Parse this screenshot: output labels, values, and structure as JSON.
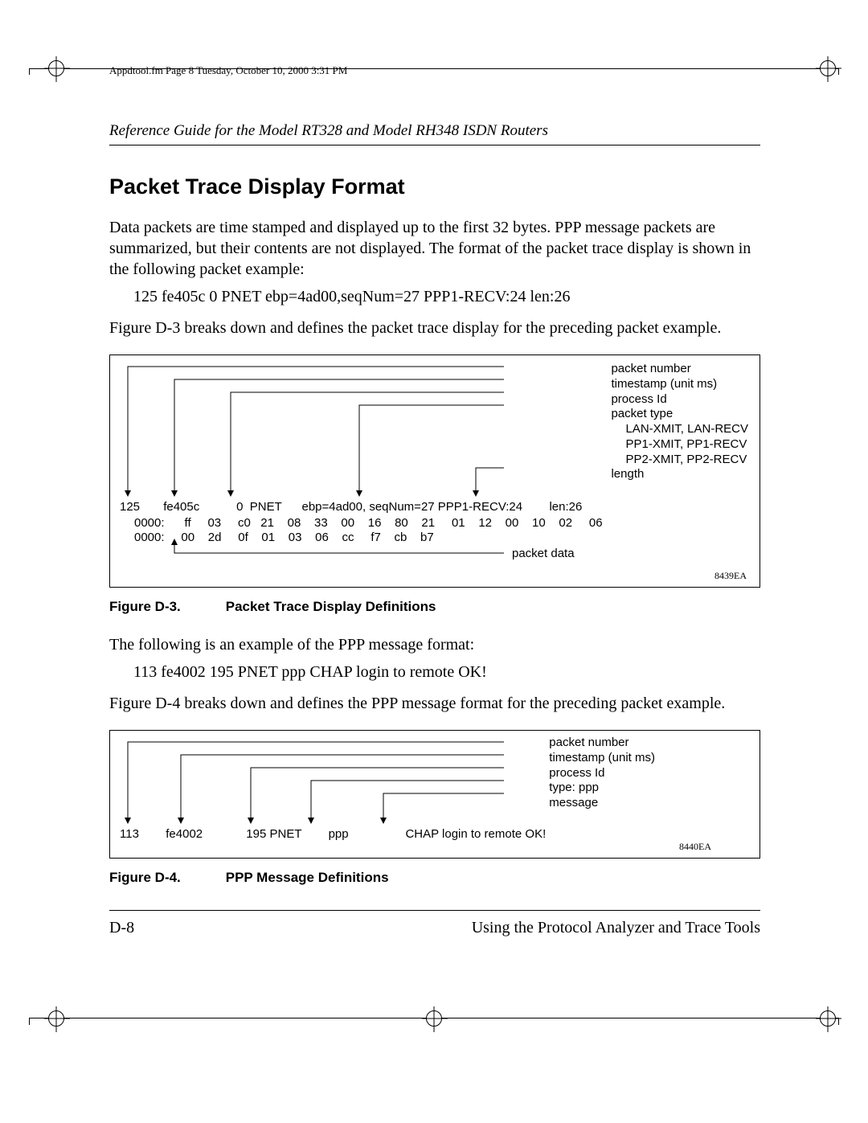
{
  "meta": {
    "topline": "Appdtool.fm  Page 8  Tuesday, October 10, 2000  3:31 PM",
    "running_head": "Reference Guide for the Model RT328 and Model RH348 ISDN Routers"
  },
  "section": {
    "title": "Packet Trace Display Format",
    "p1": "Data packets are time stamped and displayed up to the first 32 bytes.  PPP message packets are summarized, but their contents are not displayed. The format of the packet trace display is shown in the following packet example:",
    "ex1": "125   fe405c    0 PNET ebp=4ad00,seqNum=27 PPP1-RECV:24 len:26",
    "p2": "Figure D-3 breaks down and defines the packet trace display for the preceding packet example.",
    "p3": "The following is an example of the PPP message format:",
    "ex2": "113   fe4002   195 PNET  ppp CHAP login to remote OK!",
    "p4": "Figure D-4 breaks down and defines the PPP message format for the preceding packet example."
  },
  "fig3": {
    "labels": {
      "a": "packet number",
      "b": "timestamp (unit ms)",
      "c": "process Id",
      "d": "packet type",
      "d1": "LAN-XMIT, LAN-RECV",
      "d2": "PP1-XMIT, PP1-RECV",
      "d3": "PP2-XMIT, PP2-RECV",
      "e": "length",
      "f": "packet data"
    },
    "line1": "125       fe405c           0  PNET      ebp=4ad00, seqNum=27 PPP1-RECV:24        len:26",
    "line2": "0000:      ff     03     c0   21    08    33    00    16    80    21     01    12    00    10    02     06",
    "line3": "0000:     00    2d     0f    01    03    06    cc     f7    cb    b7",
    "id": "8439EA",
    "cap_num": "Figure D-3.",
    "cap_txt": "Packet Trace Display Definitions"
  },
  "fig4": {
    "labels": {
      "a": "packet number",
      "b": "timestamp (unit ms)",
      "c": "process Id",
      "d": "type: ppp",
      "e": "message"
    },
    "line1": "113        fe4002             195 PNET        ppp                 CHAP login to remote OK!",
    "id": "8440EA",
    "cap_num": "Figure D-4.",
    "cap_txt": "PPP Message Definitions"
  },
  "footer": {
    "left": "D-8",
    "right": "Using the Protocol Analyzer and Trace Tools"
  }
}
